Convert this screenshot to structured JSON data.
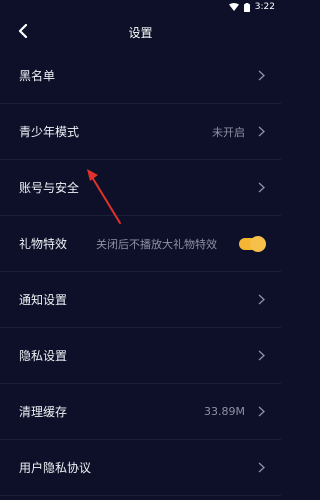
{
  "status": {
    "time": "3:22"
  },
  "header": {
    "title": "设置"
  },
  "rows": [
    {
      "label": "黑名单",
      "value": ""
    },
    {
      "label": "青少年模式",
      "value": "未开启"
    },
    {
      "label": "账号与安全",
      "value": ""
    },
    {
      "label": "礼物特效",
      "value": "关闭后不播放大礼物特效",
      "toggle_on": true
    },
    {
      "label": "通知设置",
      "value": ""
    },
    {
      "label": "隐私设置",
      "value": ""
    },
    {
      "label": "清理缓存",
      "value": "33.89M"
    },
    {
      "label": "用户隐私协议",
      "value": ""
    }
  ],
  "colors": {
    "background": "#0d1028",
    "accent": "#f5b733",
    "annotation": "#e0312b"
  },
  "icons": [
    "wifi-icon",
    "battery-icon",
    "back-arrow-icon",
    "chevron-right-icon"
  ]
}
